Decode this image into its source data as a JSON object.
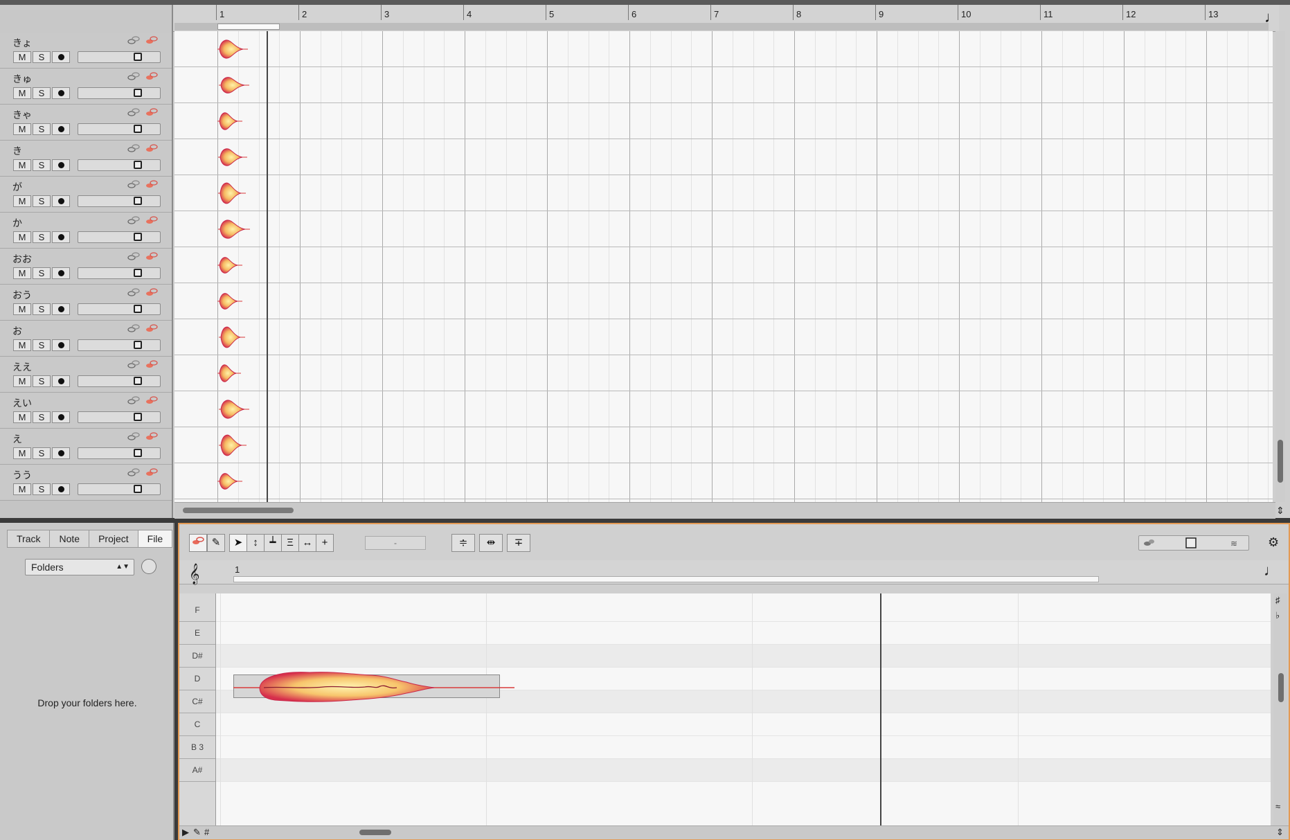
{
  "arrangement": {
    "bar_numbers": [
      "1",
      "2",
      "3",
      "4",
      "5",
      "6",
      "7",
      "8",
      "9",
      "10",
      "11",
      "12",
      "13"
    ],
    "tracks": [
      {
        "name": "きょ"
      },
      {
        "name": "きゅ"
      },
      {
        "name": "きゃ"
      },
      {
        "name": "き"
      },
      {
        "name": "が"
      },
      {
        "name": "か"
      },
      {
        "name": "おお"
      },
      {
        "name": "おう"
      },
      {
        "name": "お"
      },
      {
        "name": "ええ"
      },
      {
        "name": "えい"
      },
      {
        "name": "え"
      },
      {
        "name": "うう"
      }
    ],
    "track_buttons": {
      "mute": "M",
      "solo": "S"
    },
    "tempo_icon": "quarter-note-icon"
  },
  "browser": {
    "tabs": [
      {
        "label": "Track"
      },
      {
        "label": "Note"
      },
      {
        "label": "Project"
      },
      {
        "label": "File"
      }
    ],
    "active_tab": "File",
    "folder_select": "Folders",
    "drop_hint": "Drop your folders here."
  },
  "editor": {
    "bar_number": "1",
    "toolbar_display": "-",
    "pitch_keys": [
      "F",
      "E",
      "D#",
      "D",
      "C#",
      "C",
      "B 3",
      "A#"
    ],
    "note_pitch": "D",
    "tool_icons": [
      "pitch-link-icon",
      "wrench-icon",
      "pointer-tool-icon",
      "pitch-tool-icon",
      "amplitude-tool-icon",
      "formant-tool-icon",
      "time-tool-icon",
      "separation-tool-icon",
      "quantize-icon",
      "stretch-icon",
      "align-icon",
      "settings-icon"
    ]
  },
  "colors": {
    "blob_outer": "#d9304a",
    "blob_inner": "#ffe58a",
    "accent_border": "#e39a54"
  }
}
